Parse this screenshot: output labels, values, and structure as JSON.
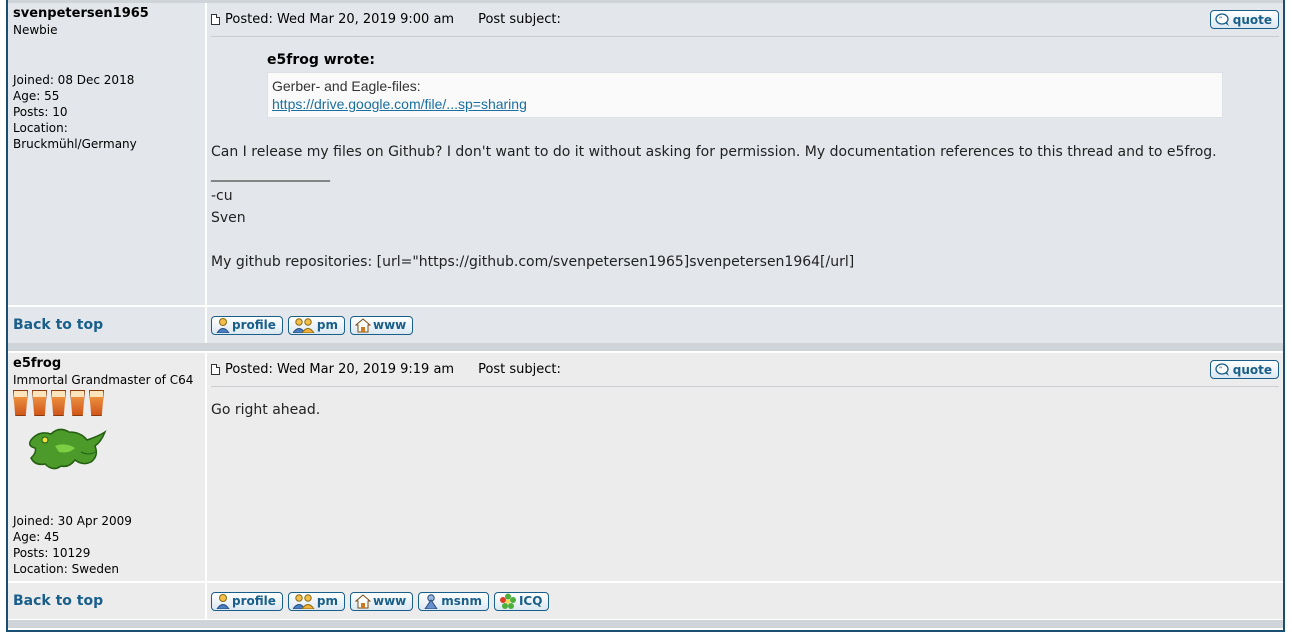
{
  "posts": [
    {
      "author": "svenpetersen1965",
      "rank": "Newbie",
      "joined": "Joined: 08 Dec 2018",
      "age": "Age: 55",
      "posts": "Posts: 10",
      "location_label": "Location:",
      "location_value": "Bruckmühl/Germany",
      "posted": "Posted: Wed Mar 20, 2019 9:00 am",
      "subject_label": "Post subject:",
      "quote_button": "quote",
      "quote_author": "e5frog wrote:",
      "quote_line": "Gerber- and Eagle-files:",
      "quote_link": "https://drive.google.com/file/...sp=sharing",
      "body_line": "Can I release my files on Github? I don't want to do it without asking for permission. My documentation references to this thread and to e5frog.",
      "sig_underline": "_________________",
      "sig_line1": "-cu",
      "sig_line2": "Sven",
      "sig_line3": "My github repositories: [url=\"https://github.com/svenpetersen1965]svenpetersen1964[/url]",
      "back_to_top": "Back to top",
      "buttons": [
        "profile",
        "pm",
        "www"
      ]
    },
    {
      "author": "e5frog",
      "rank": "Immortal Grandmaster of C64",
      "rank_icon_count": 5,
      "avatar": "frog-avatar",
      "joined": "Joined: 30 Apr 2009",
      "age": "Age: 45",
      "posts": "Posts: 10129",
      "location": "Location: Sweden",
      "posted": "Posted: Wed Mar 20, 2019 9:19 am",
      "subject_label": "Post subject:",
      "quote_button": "quote",
      "body_line": "Go right ahead.",
      "back_to_top": "Back to top",
      "buttons": [
        "profile",
        "pm",
        "www",
        "msnm",
        "ICQ"
      ]
    }
  ],
  "colors": {
    "row1_bg": "#e3e7eb",
    "row2_bg": "#ececec",
    "link": "#1a5f8a",
    "border": "#1a4f73"
  },
  "icons": {
    "post": "post-icon",
    "quote": "quote-bubble-icon",
    "profile": "person-icon",
    "pm": "two-people-icon",
    "www": "home-icon",
    "msnm": "msn-person-icon",
    "icq": "icq-flower-icon"
  }
}
